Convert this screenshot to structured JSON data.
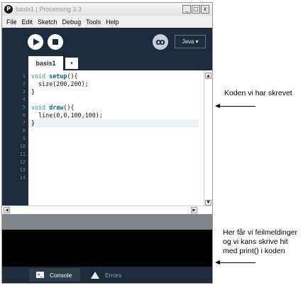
{
  "window": {
    "title": "basis1 | Processing 3.3",
    "app_icon": "P",
    "controls": {
      "minimize": "_",
      "maximize": "□",
      "close": "x"
    }
  },
  "menu": [
    "File",
    "Edit",
    "Sketch",
    "Debug",
    "Tools",
    "Help"
  ],
  "toolbar": {
    "run_icon": "play-icon",
    "stop_icon": "stop-icon",
    "debug_icon": "debugger-icon",
    "debug_glyph": "ꝏ",
    "mode_label": "Java ▾"
  },
  "tabs": {
    "active": "basis1",
    "menu_arrow": "▾"
  },
  "editor": {
    "line_numbers": [
      "1",
      "2",
      "3",
      "4",
      "5",
      "6",
      "7",
      "8",
      "9",
      "10",
      "11",
      "12",
      "13",
      "14"
    ],
    "lines": [
      {
        "kw": "void",
        "fn": "setup",
        "rest": "(){"
      },
      {
        "text": "  size(200,200);"
      },
      {
        "text": "}"
      },
      {
        "text": ""
      },
      {
        "kw": "void",
        "fn": "draw",
        "rest": "(){"
      },
      {
        "text": "  line(0,0,100,100);"
      },
      {
        "text": "}"
      }
    ],
    "highlighted_line": 7
  },
  "scroll": {
    "up": "▲",
    "down": "▼",
    "left": "◀",
    "right": "▶"
  },
  "console_tabs": {
    "console_label": "Console",
    "console_glyph": ">_",
    "errors_label": "Errors"
  },
  "annotations": {
    "code_note": "Koden vi har skrevet",
    "console_note_1": "Her får vi feilmeldinger",
    "console_note_2": "og  vi kans skrive hit",
    "console_note_3": "med print() i koden"
  },
  "colors": {
    "chrome_dark": "#1c2c3c",
    "keyword": "#33998a",
    "function": "#006699",
    "status_gray": "#7f8589"
  }
}
